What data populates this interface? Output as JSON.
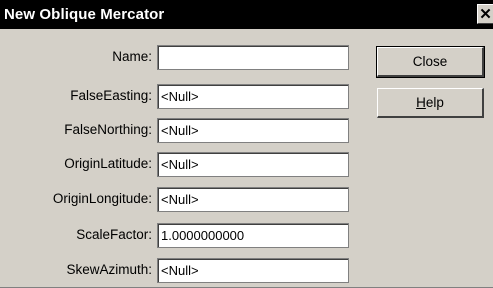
{
  "window": {
    "title": "New Oblique Mercator",
    "close_glyph": "✕"
  },
  "fields": [
    {
      "label": "Name:",
      "value": ""
    },
    {
      "label": "FalseEasting:",
      "value": "<Null>"
    },
    {
      "label": "FalseNorthing:",
      "value": "<Null>"
    },
    {
      "label": "OriginLatitude:",
      "value": "<Null>"
    },
    {
      "label": "OriginLongitude:",
      "value": "<Null>"
    },
    {
      "label": "ScaleFactor:",
      "value": "1.0000000000"
    },
    {
      "label": "SkewAzimuth:",
      "value": "<Null>"
    }
  ],
  "buttons": {
    "close_label": "Close",
    "help_label": "Help"
  }
}
